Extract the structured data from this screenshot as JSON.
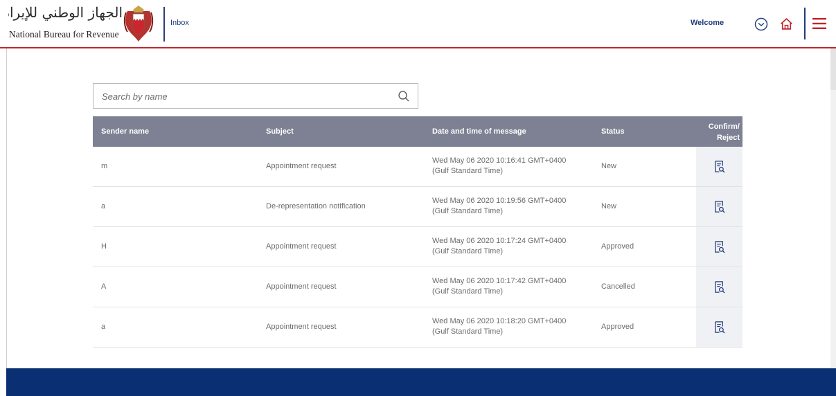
{
  "header": {
    "org_name_ar": "الجهاز الوطني للإيرادات",
    "org_name_en": "National Bureau for Revenue",
    "section_label": "Inbox",
    "welcome_label": "Welcome"
  },
  "search": {
    "placeholder": "Search by name",
    "value": ""
  },
  "table": {
    "columns": {
      "sender": "Sender name",
      "subject": "Subject",
      "datetime": "Date and time of message",
      "status": "Status",
      "action_line1": "Confirm/",
      "action_line2": "Reject"
    },
    "rows": [
      {
        "sender": "m",
        "subject": "Appointment request",
        "date_line1": "Wed May 06 2020 10:16:41 GMT+0400",
        "date_line2": "(Gulf Standard Time)",
        "status": "New"
      },
      {
        "sender": "a",
        "subject": "De-representation notification",
        "date_line1": "Wed May 06 2020 10:19:56 GMT+0400",
        "date_line2": "(Gulf Standard Time)",
        "status": "New"
      },
      {
        "sender": "H",
        "subject": "Appointment request",
        "date_line1": "Wed May 06 2020 10:17:24 GMT+0400",
        "date_line2": "(Gulf Standard Time)",
        "status": "Approved"
      },
      {
        "sender": "A",
        "subject": "Appointment request",
        "date_line1": "Wed May 06 2020 10:17:42 GMT+0400",
        "date_line2": "(Gulf Standard Time)",
        "status": "Cancelled"
      },
      {
        "sender": "a",
        "subject": "Appointment request",
        "date_line1": "Wed May 06 2020 10:18:20 GMT+0400",
        "date_line2": "(Gulf Standard Time)",
        "status": "Approved"
      }
    ]
  },
  "icons": {
    "search": "search-icon",
    "dropdown": "chevron-down-circle-icon",
    "home": "home-icon",
    "menu": "hamburger-menu-icon",
    "row_action": "document-search-icon",
    "emblem": "bahrain-emblem-icon"
  },
  "colors": {
    "accent_red": "#c1272d",
    "brand_blue": "#1f3a7a",
    "table_header": "#7d8193",
    "footer": "#0a2f73"
  }
}
